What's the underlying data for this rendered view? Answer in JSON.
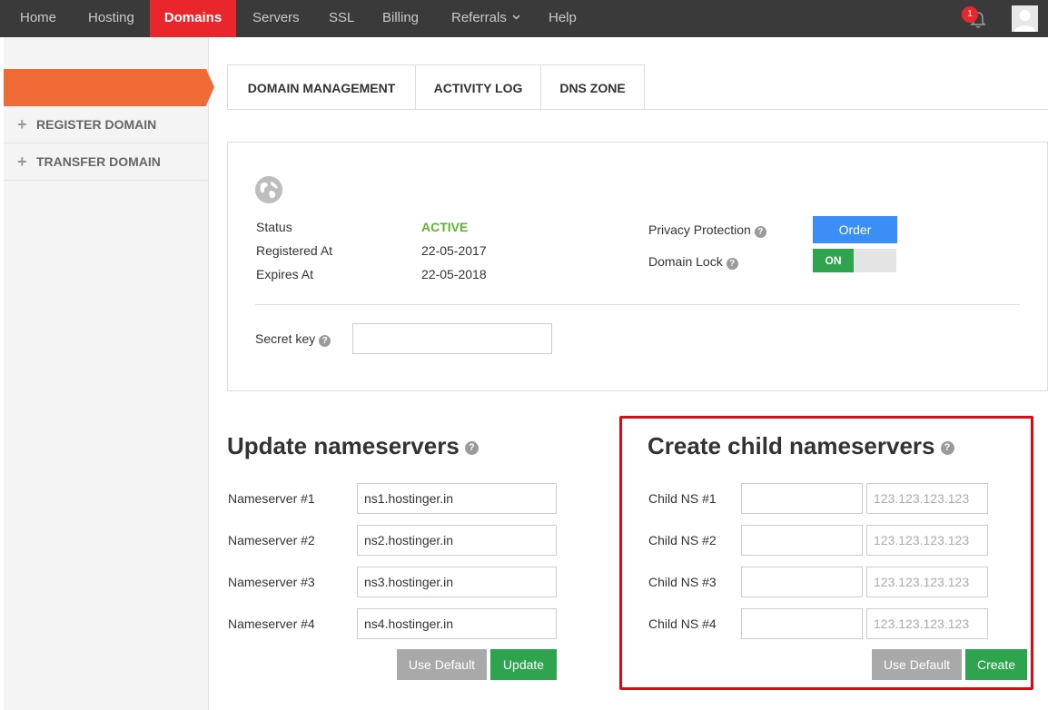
{
  "nav": {
    "items": [
      "Home",
      "Hosting",
      "Domains",
      "Servers",
      "SSL",
      "Billing",
      "Referrals",
      "Help"
    ],
    "active": "Domains",
    "notification_count": "1"
  },
  "sidebar": {
    "items": [
      "REGISTER DOMAIN",
      "TRANSFER DOMAIN"
    ]
  },
  "tabs": [
    "DOMAIN MANAGEMENT",
    "ACTIVITY LOG",
    "DNS ZONE"
  ],
  "domain_info": {
    "status_label": "Status",
    "status_value": "ACTIVE",
    "registered_label": "Registered At",
    "registered_value": "22-05-2017",
    "expires_label": "Expires At",
    "expires_value": "22-05-2018",
    "privacy_label": "Privacy Protection",
    "privacy_button": "Order",
    "lock_label": "Domain Lock",
    "lock_state": "ON",
    "secret_label": "Secret key",
    "secret_value": ""
  },
  "nameservers": {
    "title": "Update nameservers",
    "rows": [
      {
        "label": "Nameserver #1",
        "value": "ns1.hostinger.in"
      },
      {
        "label": "Nameserver #2",
        "value": "ns2.hostinger.in"
      },
      {
        "label": "Nameserver #3",
        "value": "ns3.hostinger.in"
      },
      {
        "label": "Nameserver #4",
        "value": "ns4.hostinger.in"
      }
    ],
    "default_button": "Use Default",
    "update_button": "Update"
  },
  "child_ns": {
    "title": "Create child nameservers",
    "rows": [
      {
        "label": "Child NS #1",
        "name": "",
        "ip_placeholder": "123.123.123.123"
      },
      {
        "label": "Child NS #2",
        "name": "",
        "ip_placeholder": "123.123.123.123"
      },
      {
        "label": "Child NS #3",
        "name": "",
        "ip_placeholder": "123.123.123.123"
      },
      {
        "label": "Child NS #4",
        "name": "",
        "ip_placeholder": "123.123.123.123"
      }
    ],
    "default_button": "Use Default",
    "create_button": "Create"
  },
  "colors": {
    "nav_bg": "#3a3a3a",
    "active_nav": "#e8262b",
    "sidebar_active": "#f06a35",
    "status_active": "#5cb531",
    "order_button": "#3a8ef6",
    "green_button": "#2ea44f",
    "highlight_box": "#e30613"
  },
  "icons": [
    "bell-icon",
    "user-avatar-icon",
    "globe-icon",
    "plus-icon",
    "help-icon",
    "chevron-down-icon"
  ]
}
